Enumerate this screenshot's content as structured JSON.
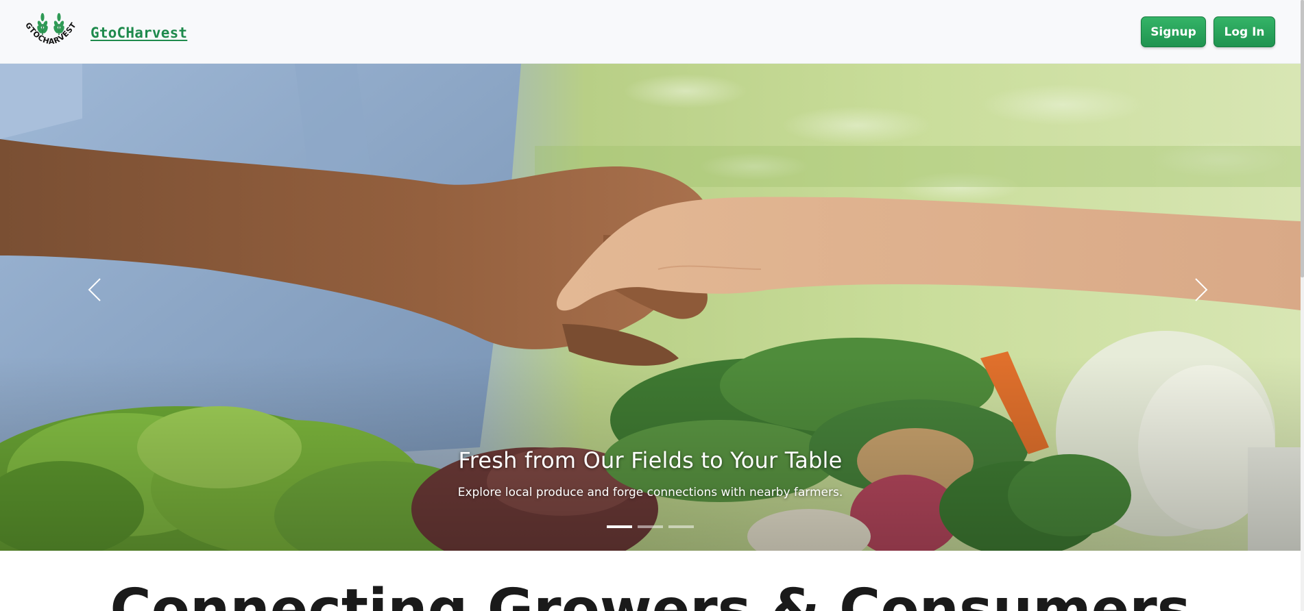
{
  "navbar": {
    "logo_text": "GTOCHARVEST",
    "brand_name": "GtoCHarvest",
    "signup_label": "Signup",
    "login_label": "Log In",
    "accent_color": "#1e8a4c"
  },
  "hero": {
    "title": "Fresh from Our Fields to Your Table",
    "subtitle": "Explore local produce and forge connections with nearby farmers.",
    "prev_icon": "chevron-left-icon",
    "next_icon": "chevron-right-icon",
    "slides": [
      {
        "active": true
      },
      {
        "active": false
      },
      {
        "active": false
      }
    ]
  },
  "section": {
    "heading": "Connecting Growers & Consumers"
  }
}
